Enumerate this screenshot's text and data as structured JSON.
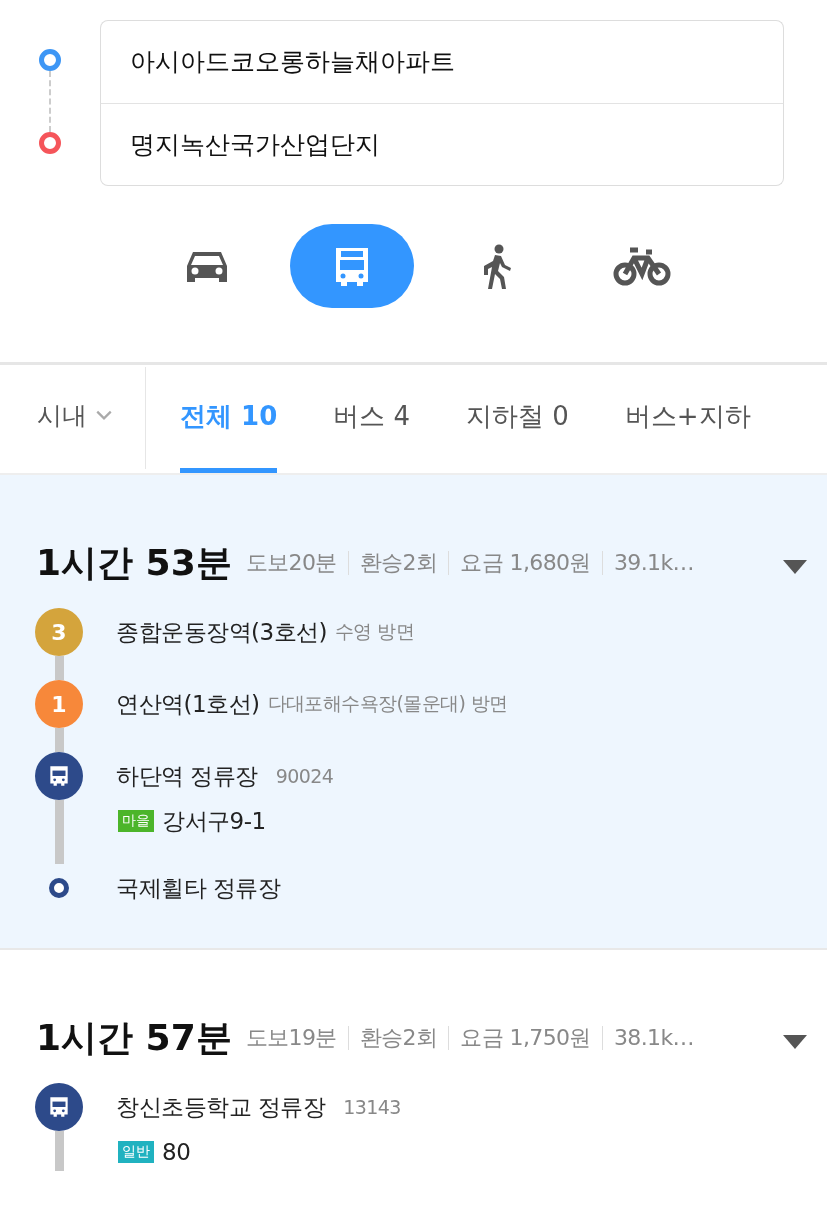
{
  "search": {
    "origin": "아시아드코오롱하늘채아파트",
    "destination": "명지녹산국가산업단지"
  },
  "modes": [
    {
      "kind": "car",
      "selected": false
    },
    {
      "kind": "bus",
      "selected": true
    },
    {
      "kind": "walk",
      "selected": false
    },
    {
      "kind": "bike",
      "selected": false
    }
  ],
  "region_filter": {
    "label": "시내"
  },
  "tabs": [
    {
      "label": "전체 10",
      "selected": true
    },
    {
      "label": "버스 4",
      "selected": false
    },
    {
      "label": "지하철 0",
      "selected": false
    },
    {
      "label": "버스+지하",
      "selected": false
    }
  ],
  "routes": [
    {
      "duration": "1시간 53분",
      "selected": true,
      "stats": [
        "도보20분",
        "환승2회",
        "요금 1,680원",
        "39.1k…"
      ],
      "steps": [
        {
          "kind": "subway",
          "badge": "3",
          "color": "#d4a43c",
          "name": "종합운동장역(3호선)",
          "detail": "수영 방면"
        },
        {
          "kind": "subway",
          "badge": "1",
          "color": "#f7883a",
          "name": "연산역(1호선)",
          "detail": "다대포해수욕장(몰운대) 방면"
        },
        {
          "kind": "bus",
          "name": "하단역 정류장",
          "detail": "90024",
          "buses": [
            {
              "type": "마을",
              "color": "#4cb52a",
              "number": "강서구9-1"
            }
          ]
        },
        {
          "kind": "stop",
          "name": "국제휠타 정류장"
        }
      ]
    },
    {
      "duration": "1시간 57분",
      "selected": false,
      "stats": [
        "도보19분",
        "환승2회",
        "요금 1,750원",
        "38.1k…"
      ],
      "steps": [
        {
          "kind": "bus",
          "name": "창신초등학교 정류장",
          "detail": "13143",
          "buses": [
            {
              "type": "일반",
              "color": "#20b2c0",
              "number": "80"
            }
          ]
        }
      ]
    }
  ]
}
